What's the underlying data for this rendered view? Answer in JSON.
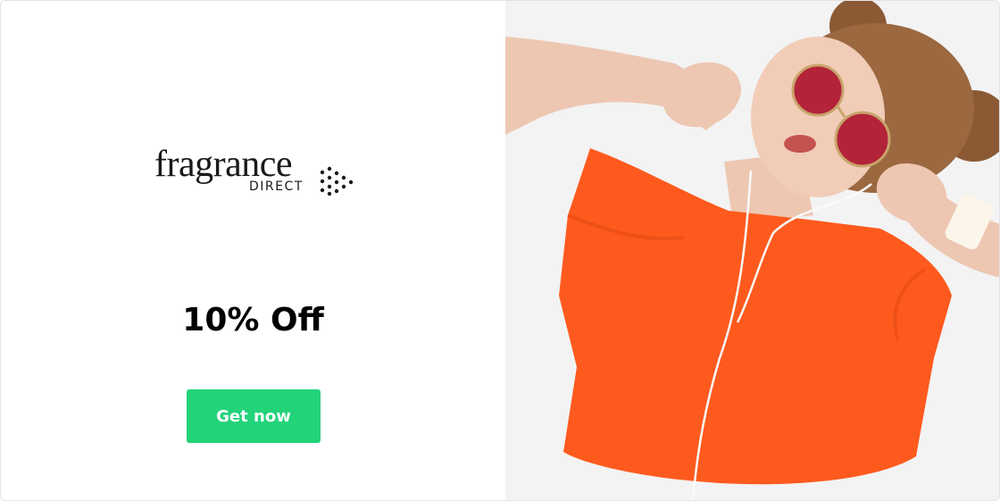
{
  "brand": {
    "name": "fragrance",
    "sub": "DIRECT",
    "logo_icon": "dots-arrow-icon"
  },
  "offer": {
    "title": "10% Off"
  },
  "cta": {
    "label": "Get now",
    "color": "#22d37a"
  },
  "hero": {
    "subject": "woman-in-orange-tshirt-with-sunglasses-and-earphones",
    "accent": "#ff5a1e"
  }
}
